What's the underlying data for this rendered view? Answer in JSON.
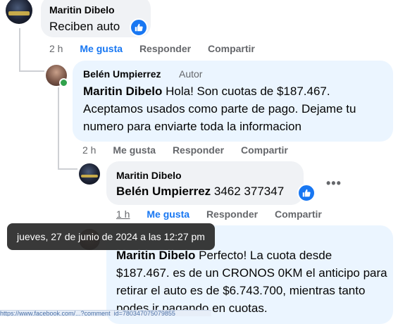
{
  "colors": {
    "link_blue": "#1877f2",
    "secondary_text": "#65676b",
    "bubble_grey": "#f0f2f5",
    "bubble_blue": "#ebf5ff"
  },
  "comments": [
    {
      "author": "Maritin Dibelo",
      "text": "Reciben auto",
      "time": "2 h",
      "like": "Me gusta",
      "reply": "Responder",
      "share": "Compartir"
    },
    {
      "author": "Belén Umpierrez",
      "tag": "Autor",
      "mention": "Maritin Dibelo",
      "text": " Hola! Son cuotas de $187.467. Aceptamos usados como parte de pago. Dejame tu numero para enviarte toda la informacion",
      "time": "2 h",
      "like": "Me gusta",
      "reply": "Responder",
      "share": "Compartir"
    },
    {
      "author": "Maritin Dibelo",
      "mention": "Belén Umpierrez",
      "text": " 3462 377347",
      "time": "1 h",
      "like": "Me gusta",
      "reply": "Responder",
      "share": "Compartir"
    },
    {
      "mention": "Maritin Dibelo",
      "text": " Perfecto! La cuota desde $187.467. es de un CRONOS 0KM el anticipo para retirar el auto es de $6.743.700, mientras tanto podes ir pagando en cuotas."
    }
  ],
  "tooltip": "jueves, 27 de junio de 2024 a las 12:27 pm",
  "more_options": "•••",
  "status_url": "https://www.facebook.com/...?comment_id=780347075079855"
}
